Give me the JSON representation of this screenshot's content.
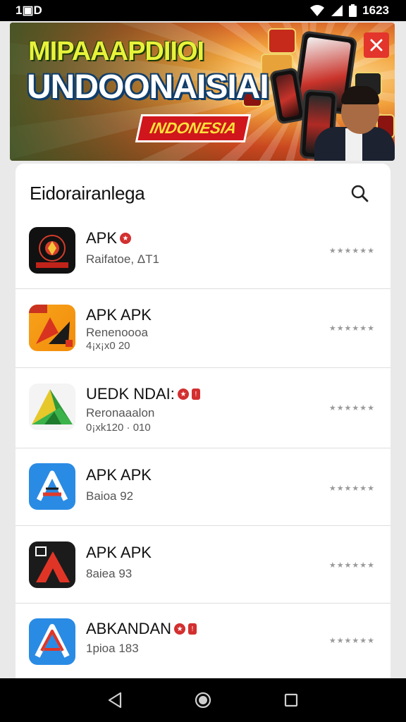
{
  "status_bar": {
    "left": "1▣D",
    "time": "1623"
  },
  "banner": {
    "line1": "MIPAAAPDIIOI",
    "line2": "UNDOONAISIAI",
    "badge": "INDONESIA",
    "close_icon": "close-icon"
  },
  "sheet": {
    "title": "Eidorairanlega",
    "search_icon": "search-icon"
  },
  "apps": [
    {
      "name": "APK",
      "sub": "Raifatoe, ΔТ1",
      "sub2": "",
      "rating": "★★★★★★",
      "badge": true,
      "badge_sq": false
    },
    {
      "name": "APK APK",
      "sub": "Renenoooa",
      "sub2": "4¡x¡x0 20",
      "rating": "★★★★★★",
      "badge": false,
      "badge_sq": false
    },
    {
      "name": "UEDK NDAI:",
      "sub": "Reronaaalon",
      "sub2": "0¡xk120 · 010",
      "rating": "★★★★★★",
      "badge": true,
      "badge_sq": true
    },
    {
      "name": "APK APK",
      "sub": "Baioa 92",
      "sub2": "",
      "rating": "★★★★★★",
      "badge": false,
      "badge_sq": false
    },
    {
      "name": "APK APK",
      "sub": "8aiea 93",
      "sub2": "",
      "rating": "★★★★★★",
      "badge": false,
      "badge_sq": false
    },
    {
      "name": "ABKANDAN",
      "sub": "1pioa 183",
      "sub2": "",
      "rating": "★★★★★★",
      "badge": true,
      "badge_sq": true
    }
  ],
  "nav": {
    "back_icon": "back-icon",
    "home_icon": "home-icon",
    "recents_icon": "recents-icon"
  },
  "colors": {
    "accent_red": "#d32f2f",
    "sheet_bg": "#ffffff",
    "nav_bg": "#000000"
  }
}
